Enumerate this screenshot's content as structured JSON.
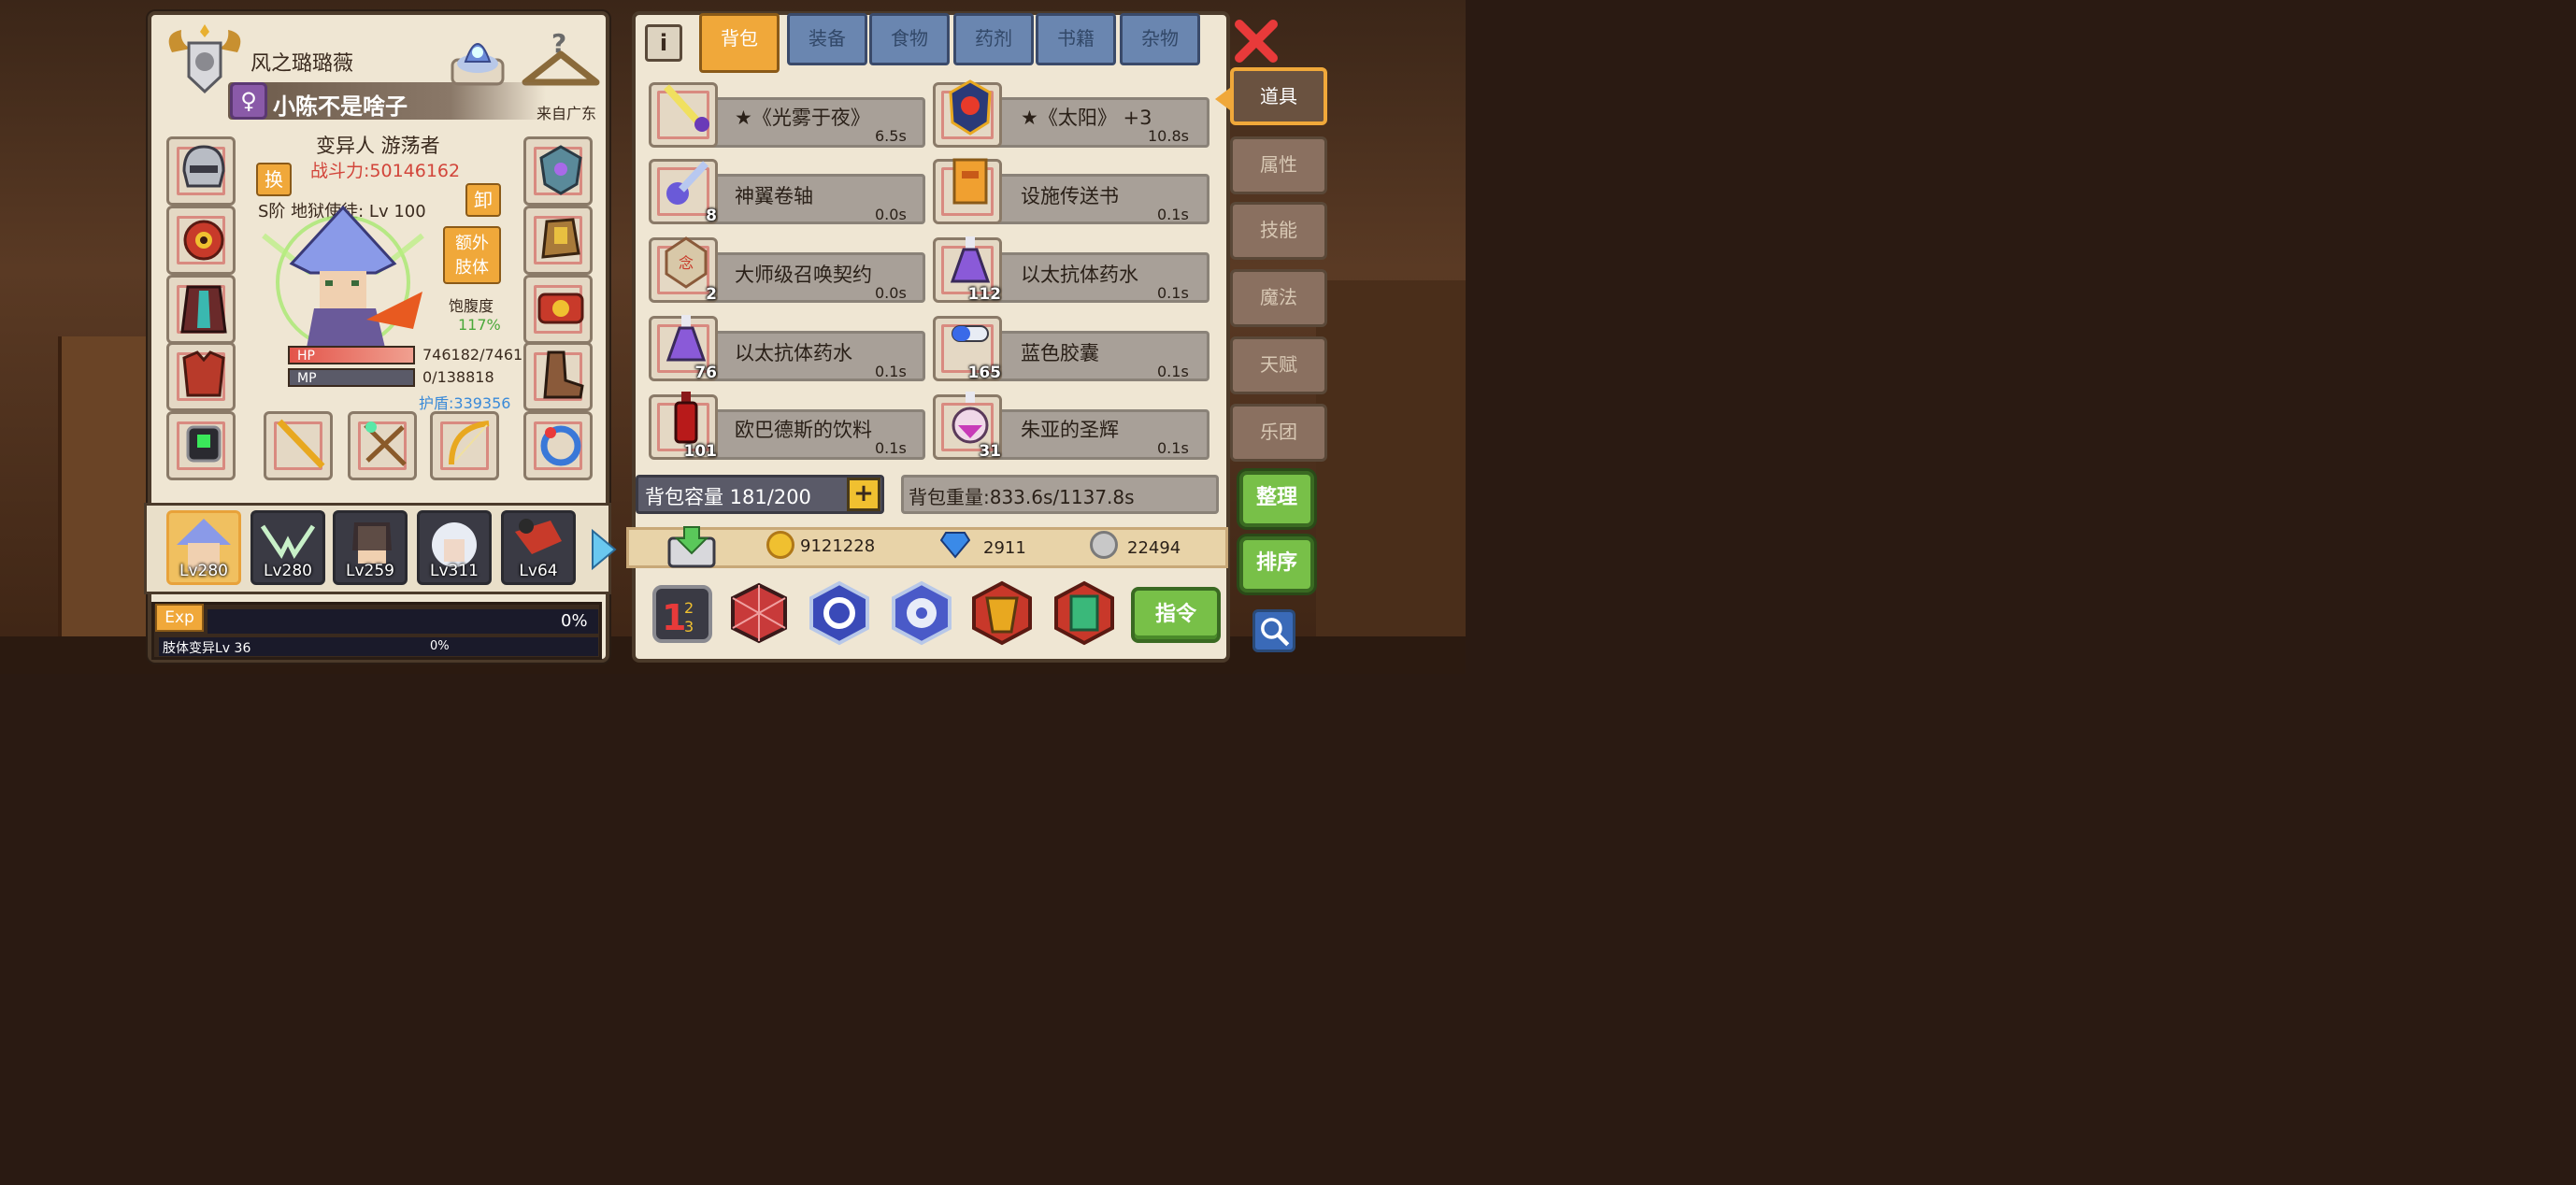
{
  "character": {
    "guild_name": "风之璐璐薇",
    "gender_symbol": "♀",
    "player_name": "小陈不是啥子",
    "origin": "来自广东",
    "class_title": "变异人 游荡者",
    "power": "战斗力:50146162",
    "swap_label": "换",
    "unload_label": "卸",
    "rank_title": "S阶 地狱使徒: Lv 100",
    "extra_limb_label": "额外\n肢体",
    "satiety_label": "饱腹度",
    "satiety_value": "117%",
    "hp_label": "HP",
    "mp_label": "MP",
    "hp_value": "746182/7461",
    "mp_value": "0/138818",
    "shield_value": "护盾:339356"
  },
  "party": [
    {
      "level": "Lv280",
      "active": true
    },
    {
      "level": "Lv280",
      "active": false
    },
    {
      "level": "Lv259",
      "active": false
    },
    {
      "level": "Lv311",
      "active": false
    },
    {
      "level": "Lv64",
      "active": false
    }
  ],
  "exp": {
    "tag": "Exp",
    "percent": "0%",
    "limb_label": "肢体变异Lv 36",
    "limb_percent": "0%"
  },
  "inventory": {
    "tabs": [
      "背包",
      "装备",
      "食物",
      "药剂",
      "书籍",
      "杂物"
    ],
    "active_tab": "背包",
    "items": [
      {
        "name": "★《光雾于夜》",
        "time": "6.5s",
        "qty": ""
      },
      {
        "name": "★《太阳》 +3",
        "time": "10.8s",
        "qty": ""
      },
      {
        "name": "神翼卷轴",
        "time": "0.0s",
        "qty": "8"
      },
      {
        "name": "设施传送书",
        "time": "0.1s",
        "qty": ""
      },
      {
        "name": "大师级召唤契约",
        "time": "0.0s",
        "qty": "2"
      },
      {
        "name": "以太抗体药水",
        "time": "0.1s",
        "qty": "112"
      },
      {
        "name": "以太抗体药水",
        "time": "0.1s",
        "qty": "76"
      },
      {
        "name": "蓝色胶囊",
        "time": "0.1s",
        "qty": "165"
      },
      {
        "name": "欧巴德斯的饮料",
        "time": "0.1s",
        "qty": "101"
      },
      {
        "name": "朱亚的圣辉",
        "time": "0.1s",
        "qty": "31"
      }
    ],
    "capacity": "背包容量 181/200",
    "capacity_plus": "+",
    "weight": "背包重量:833.6s/1137.8s",
    "gold": "9121228",
    "gems": "2911",
    "silver": "22494",
    "command_label": "指令",
    "info_label": "i"
  },
  "side_tabs": [
    "道具",
    "属性",
    "技能",
    "魔法",
    "天赋",
    "乐团"
  ],
  "side_active": "道具",
  "side_buttons": {
    "organize": "整理",
    "sort": "排序"
  },
  "colors": {
    "accent_orange": "#f0a83a",
    "tab_blue": "#6a86b0",
    "green_button": "#78c048",
    "power_red": "#d2453a",
    "shield_blue": "#3a8ad8"
  }
}
